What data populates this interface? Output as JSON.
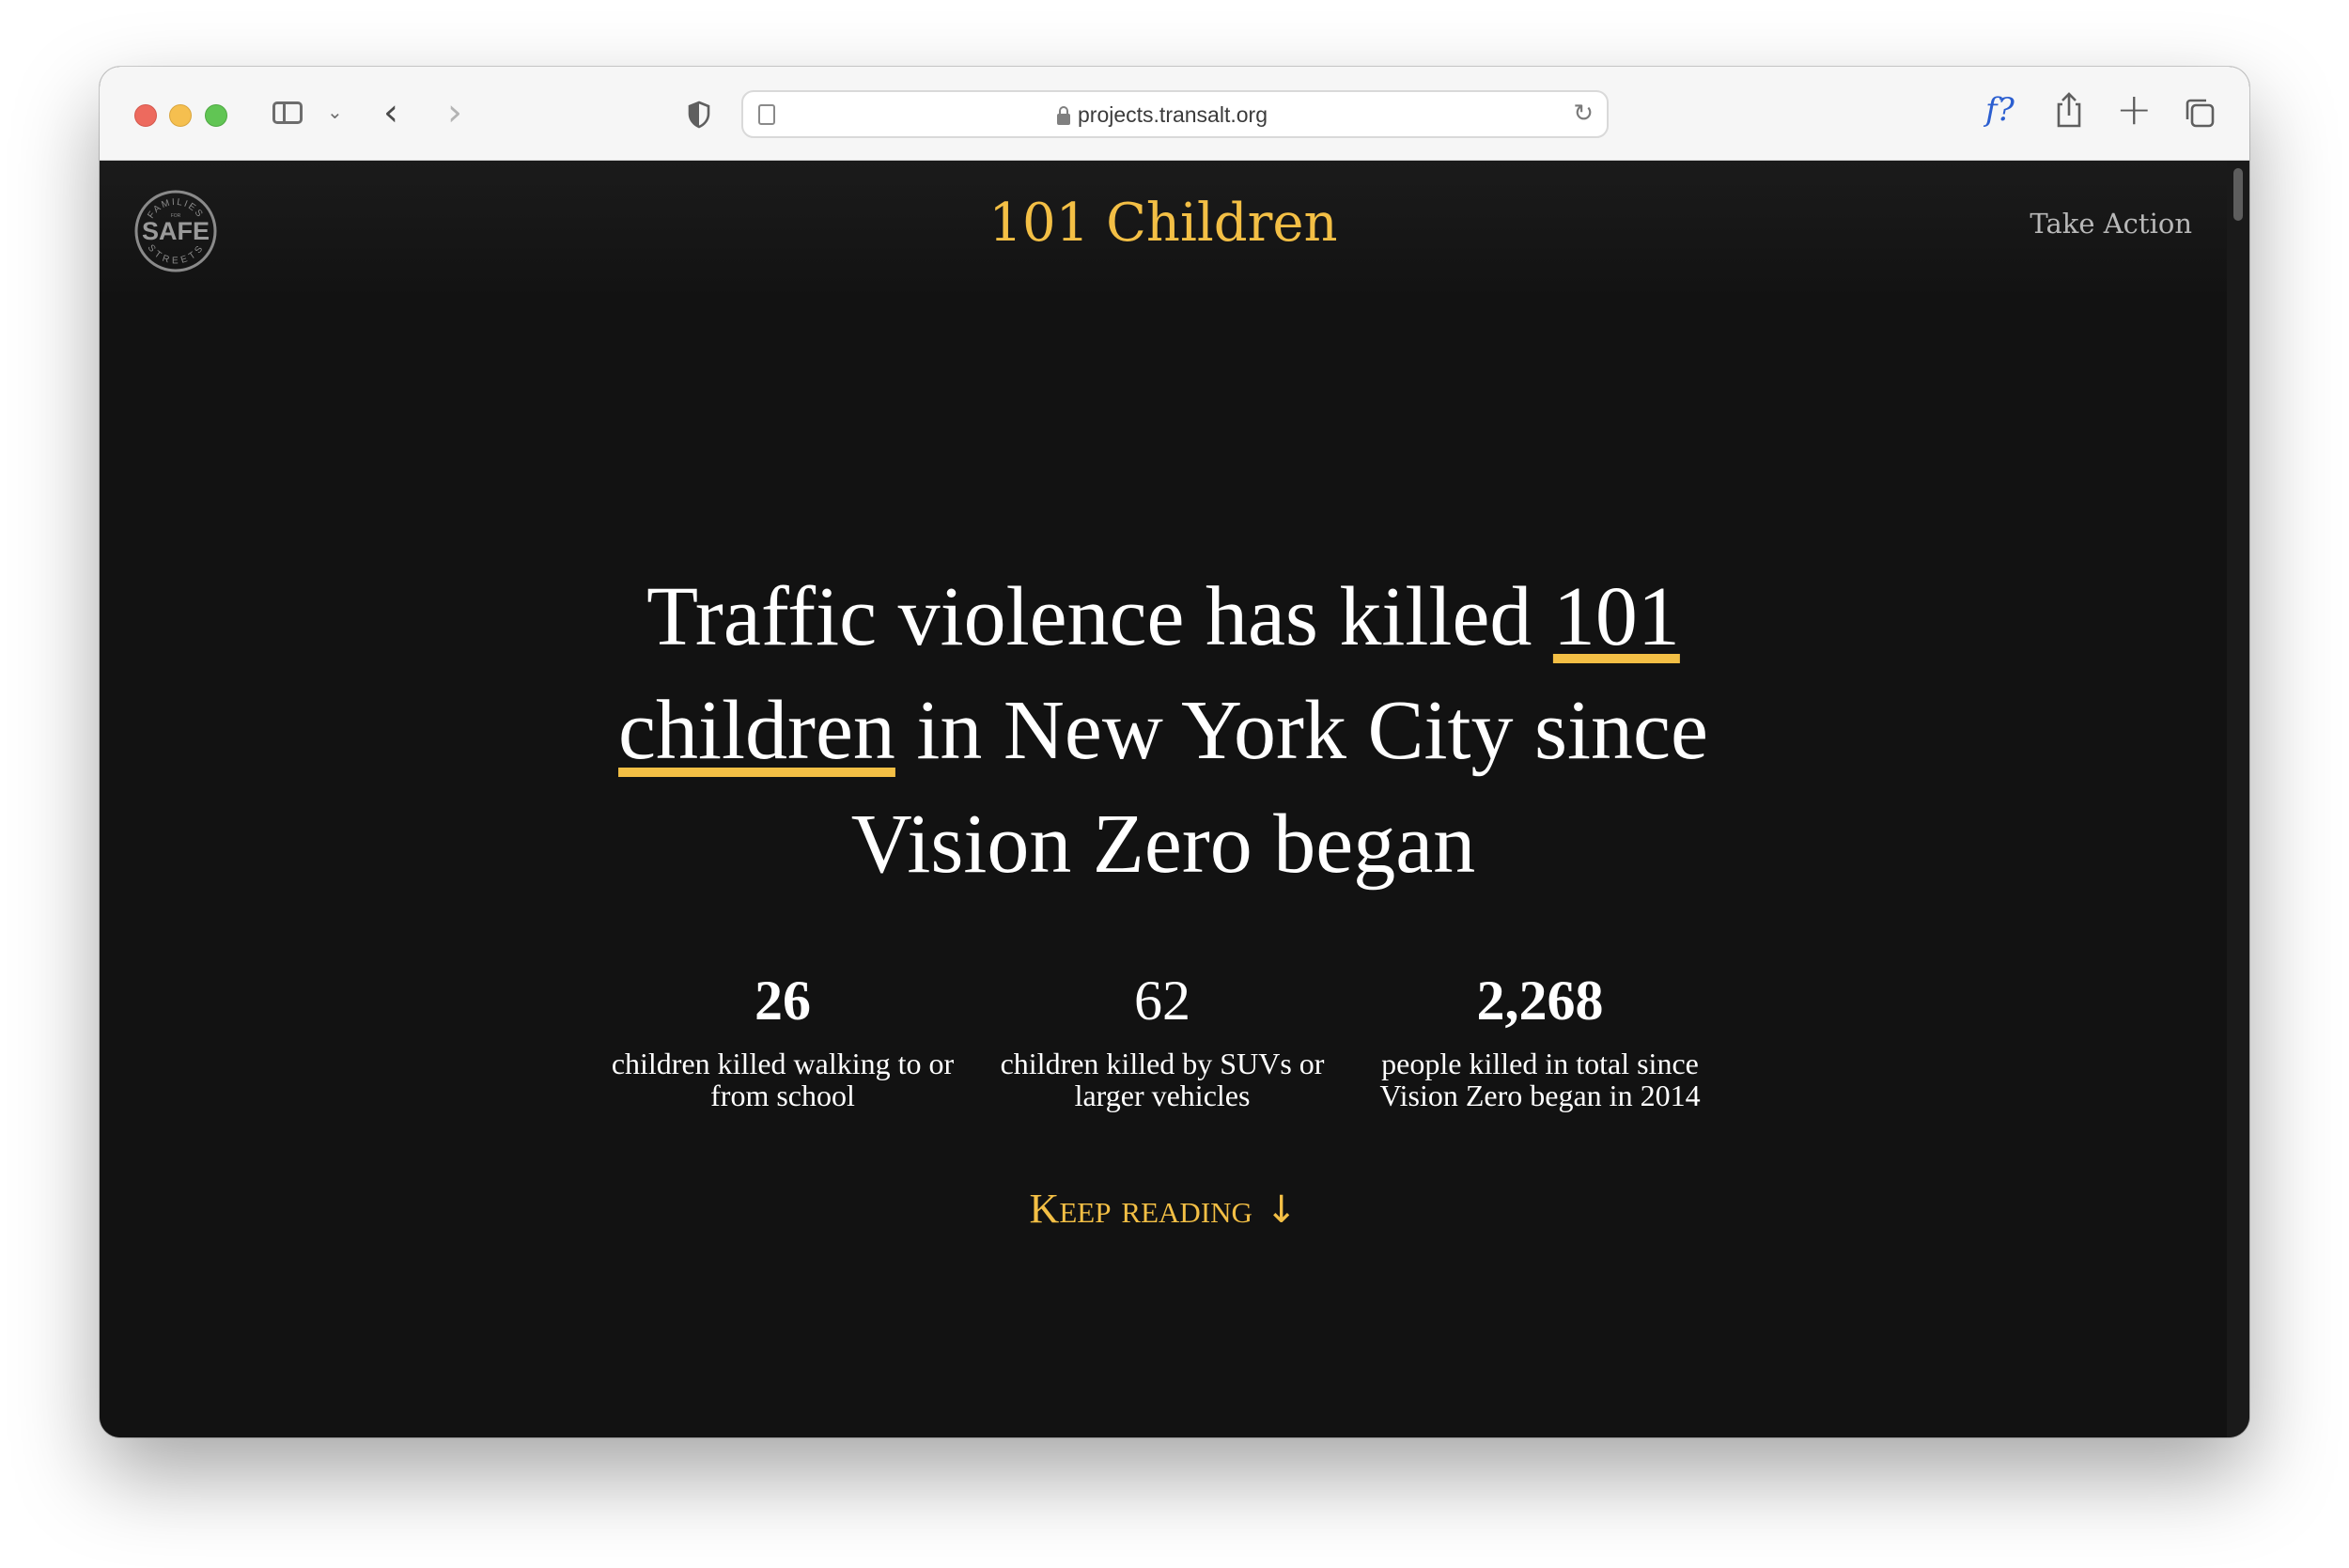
{
  "browser": {
    "url": "projects.transalt.org",
    "toolbar_icons": [
      "sidebar-icon",
      "chevron-down-icon",
      "back-icon",
      "forward-icon",
      "shield-icon",
      "reader-icon",
      "lock-icon",
      "reload-icon",
      "fx-icon",
      "share-icon",
      "plus-icon",
      "tabs-icon"
    ],
    "fx_label": "f?",
    "back_glyph": "‹",
    "forward_glyph": "›",
    "chevron_glyph": "⌄",
    "reload_glyph": "↻",
    "plus_glyph": "+"
  },
  "header": {
    "title": "101 Children",
    "take_action": "Take Action",
    "logo_text": {
      "top": "FAMILIES",
      "small": "FOR",
      "main": "SAFE",
      "bottom": "STREETS"
    }
  },
  "hero": {
    "line_a": "Traffic violence has killed ",
    "highlight": "101 children",
    "line_b": " in New York City since Vision Zero began"
  },
  "stats": [
    {
      "number": "26",
      "label": "children killed walking to or from school"
    },
    {
      "number": "62",
      "label": "children killed by SUVs or larger vehicles"
    },
    {
      "number": "2,268",
      "label": "people killed in total since Vision Zero began in 2014"
    }
  ],
  "keep_reading": {
    "label": "Keep reading",
    "arrow": "↓"
  },
  "colors": {
    "accent": "#f3bf45",
    "background": "#121212",
    "text": "#ffffff",
    "nav_text": "#b8b8b8"
  }
}
